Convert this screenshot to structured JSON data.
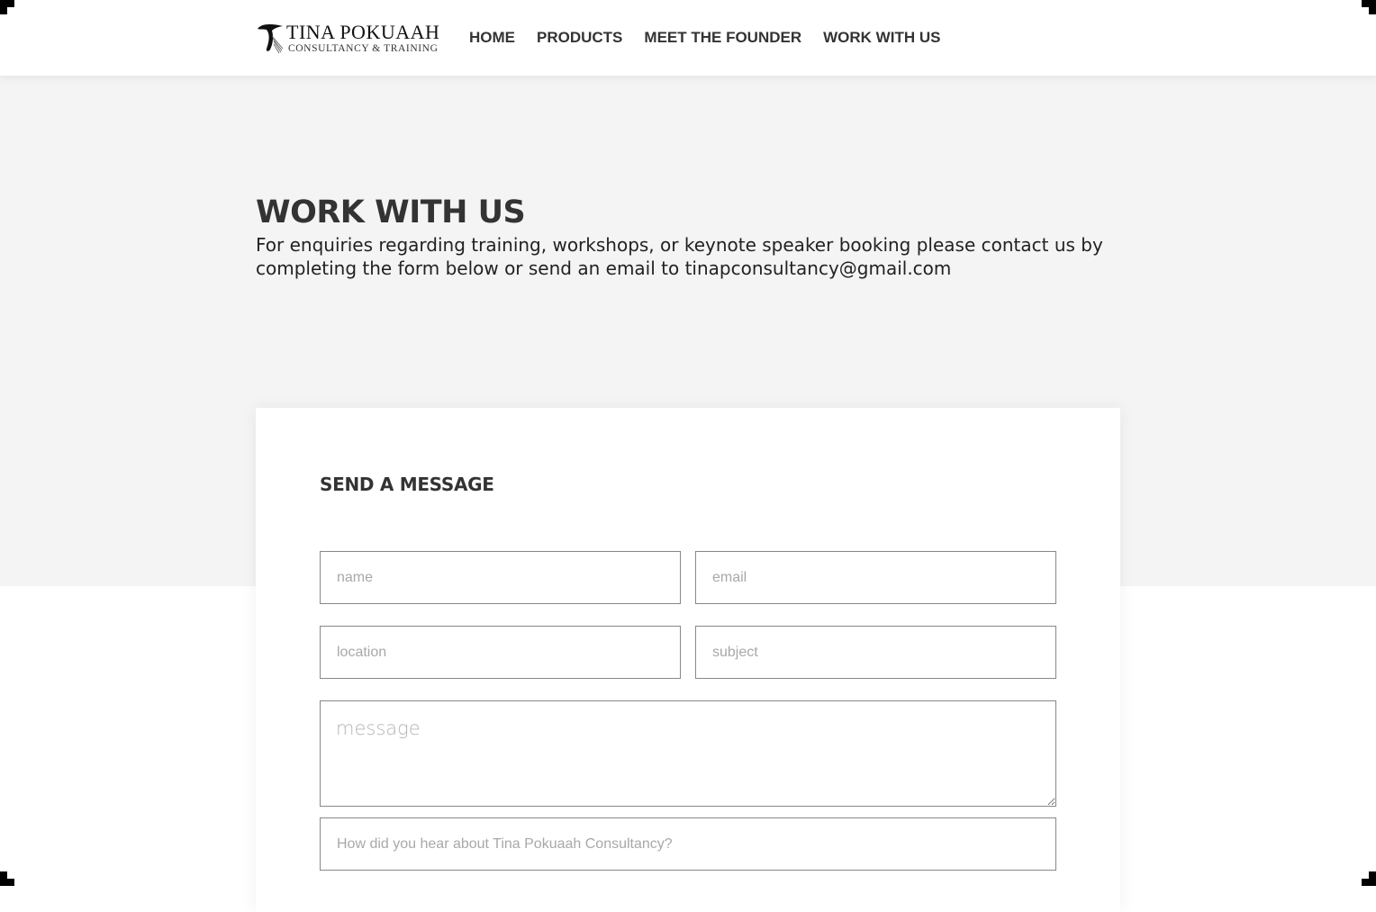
{
  "brand": {
    "name": "TINA POKUAAH",
    "tagline": "CONSULTANCY & TRAINING",
    "logo_icon": "stylized-t-logo-icon"
  },
  "nav": {
    "items": [
      {
        "label": "HOME"
      },
      {
        "label": "PRODUCTS"
      },
      {
        "label": "MEET THE FOUNDER"
      },
      {
        "label": "WORK WITH US"
      }
    ]
  },
  "hero": {
    "title": "WORK WITH US",
    "text": "For enquiries regarding training, workshops, or keynote speaker booking please contact us by completing the form below or send an email to tinapconsultancy@gmail.com"
  },
  "form": {
    "title": "SEND A MESSAGE",
    "name_placeholder": "name",
    "email_placeholder": "email",
    "location_placeholder": "location",
    "subject_placeholder": "subject",
    "message_placeholder": "message",
    "hear_placeholder": "How did you hear about Tina Pokuaah Consultancy?"
  },
  "colors": {
    "text": "#333333",
    "hero_background": "#f4f4f4",
    "field_border": "#888888",
    "placeholder": "#a8a8a8"
  }
}
